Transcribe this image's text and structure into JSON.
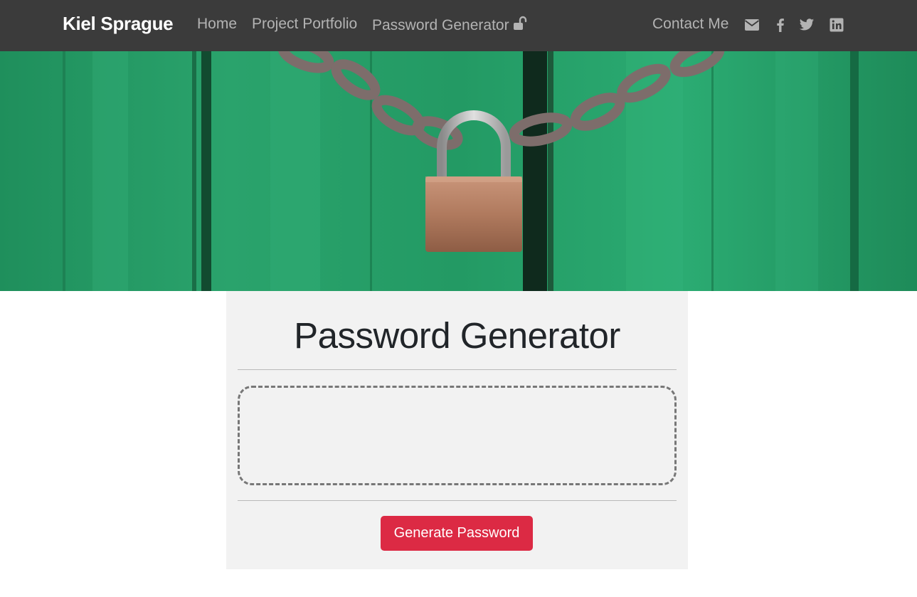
{
  "navbar": {
    "brand": "Kiel Sprague",
    "links": {
      "home": "Home",
      "portfolio": "Project Portfolio",
      "generator": "Password Generator",
      "contact": "Contact Me"
    },
    "icons": [
      "unlock-icon",
      "envelope-icon",
      "facebook-icon",
      "twitter-icon",
      "linkedin-icon"
    ],
    "background_color": "#3b3b3b",
    "link_color": "#b3b3b3"
  },
  "hero": {
    "image": "green-wooden-door-with-chained-padlock"
  },
  "generator": {
    "title": "Password Generator",
    "password_value": "",
    "button_label": "Generate Password",
    "button_color": "#dc2a44",
    "card_color": "#f2f2f2"
  }
}
